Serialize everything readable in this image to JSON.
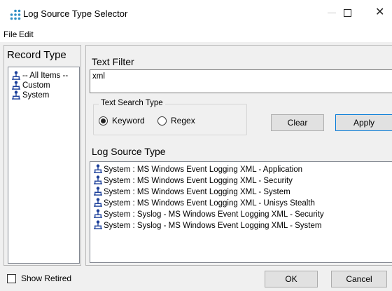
{
  "window": {
    "title": "Log Source Type Selector",
    "icon": "dots-app-icon",
    "controls": [
      "minimize",
      "maximize",
      "close"
    ],
    "close_glyph": "✕"
  },
  "menu": {
    "items": [
      {
        "label": "File"
      },
      {
        "label": "Edit"
      }
    ]
  },
  "record_type": {
    "heading": "Record Type",
    "items": [
      {
        "label": "-- All Items --",
        "icon": "record-icon"
      },
      {
        "label": "Custom",
        "icon": "record-icon"
      },
      {
        "label": "System",
        "icon": "record-icon"
      }
    ]
  },
  "text_filter": {
    "heading": "Text Filter",
    "value": "xml"
  },
  "search_type": {
    "legend": "Text Search Type",
    "options": [
      {
        "label": "Keyword",
        "checked": true
      },
      {
        "label": "Regex",
        "checked": false
      }
    ]
  },
  "buttons": {
    "clear": "Clear",
    "apply": "Apply",
    "ok": "OK",
    "cancel": "Cancel"
  },
  "log_source_type": {
    "heading": "Log Source Type",
    "items": [
      {
        "label": "System : MS Windows Event Logging XML - Application"
      },
      {
        "label": "System : MS Windows Event Logging XML - Security"
      },
      {
        "label": "System : MS Windows Event Logging XML - System"
      },
      {
        "label": "System : MS Windows Event Logging XML - Unisys Stealth"
      },
      {
        "label": "System : Syslog - MS Windows Event Logging XML - Security"
      },
      {
        "label": "System : Syslog - MS Windows Event Logging XML - System"
      }
    ]
  },
  "show_retired": {
    "label": "Show Retired",
    "checked": false
  },
  "colors": {
    "accent_blue": "#0078d7",
    "icon_blue": "#1b3f9a",
    "app_icon_teal": "#2d8fc4"
  }
}
